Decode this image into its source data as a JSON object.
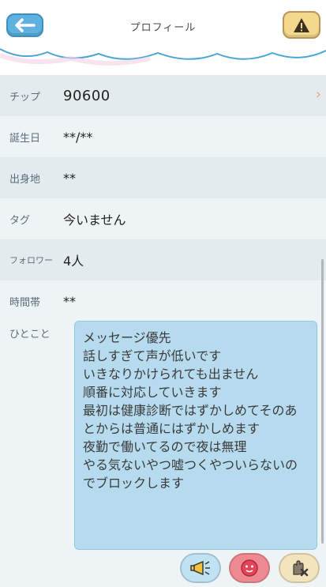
{
  "header": {
    "title": "プロフィール"
  },
  "profile": {
    "rows": [
      {
        "label": "チップ",
        "value": "90600"
      },
      {
        "label": "誕生日",
        "value": "**/**"
      },
      {
        "label": "出身地",
        "value": "**"
      },
      {
        "label": "タグ",
        "value": "今いません"
      },
      {
        "label": "フォロワー",
        "value": "4人"
      },
      {
        "label": "時間帯",
        "value": "**"
      }
    ],
    "bio_label": "ひとこと",
    "bio_text": "メッセージ優先\n話しすぎて声が低いです\nいきなりかけられても出ません\n順番に対応していきます\n最初は健康診断ではずかしめてそのあとからは普通にはずかしめます\n夜勤で働いてるので夜は無理\nやる気ないやつ嘘つくやついらないのでブロックします"
  },
  "icons": {
    "back": "back-arrow-icon",
    "warning": "warning-icon",
    "megaphone": "megaphone-icon",
    "face": "face-icon",
    "block": "block-hand-icon"
  },
  "colors": {
    "accent_blue": "#5fb2e0",
    "bio_bg": "#b6dbee",
    "warning_bg": "#f2d98d"
  }
}
